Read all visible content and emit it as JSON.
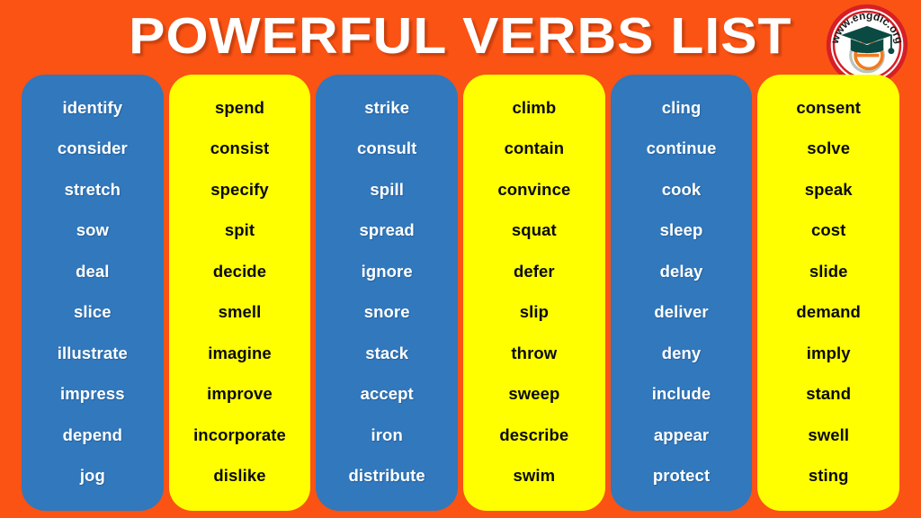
{
  "header": {
    "title": "POWERFUL VERBS LIST",
    "logo": {
      "curved_text": "www.engdic.org",
      "center_letter": "e",
      "icon": "graduation-cap-icon"
    }
  },
  "colors": {
    "background_orange": "#fa5314",
    "column_blue": "#3178bd",
    "column_yellow": "#ffff00",
    "title_white": "#ffffff",
    "logo_ring_red": "#d61f26",
    "logo_cap_green": "#0b4a42",
    "logo_e_orange": "#f07c1e"
  },
  "columns": [
    {
      "id": "column-1",
      "color": "blue",
      "verbs": [
        "identify",
        "consider",
        "stretch",
        "sow",
        "deal",
        "slice",
        "illustrate",
        "impress",
        "depend",
        "jog"
      ]
    },
    {
      "id": "column-2",
      "color": "yellow",
      "verbs": [
        "spend",
        "consist",
        "specify",
        "spit",
        "decide",
        "smell",
        "imagine",
        "improve",
        "incorporate",
        "dislike"
      ]
    },
    {
      "id": "column-3",
      "color": "blue",
      "verbs": [
        "strike",
        "consult",
        "spill",
        "spread",
        "ignore",
        "snore",
        "stack",
        "accept",
        "iron",
        "distribute"
      ]
    },
    {
      "id": "column-4",
      "color": "yellow",
      "verbs": [
        "climb",
        "contain",
        "convince",
        "squat",
        "defer",
        "slip",
        "throw",
        "sweep",
        "describe",
        "swim"
      ]
    },
    {
      "id": "column-5",
      "color": "blue",
      "verbs": [
        "cling",
        "continue",
        "cook",
        "sleep",
        "delay",
        "deliver",
        "deny",
        "include",
        "appear",
        "protect"
      ]
    },
    {
      "id": "column-6",
      "color": "yellow",
      "verbs": [
        "consent",
        "solve",
        "speak",
        "cost",
        "slide",
        "demand",
        "imply",
        "stand",
        "swell",
        "sting"
      ]
    }
  ]
}
